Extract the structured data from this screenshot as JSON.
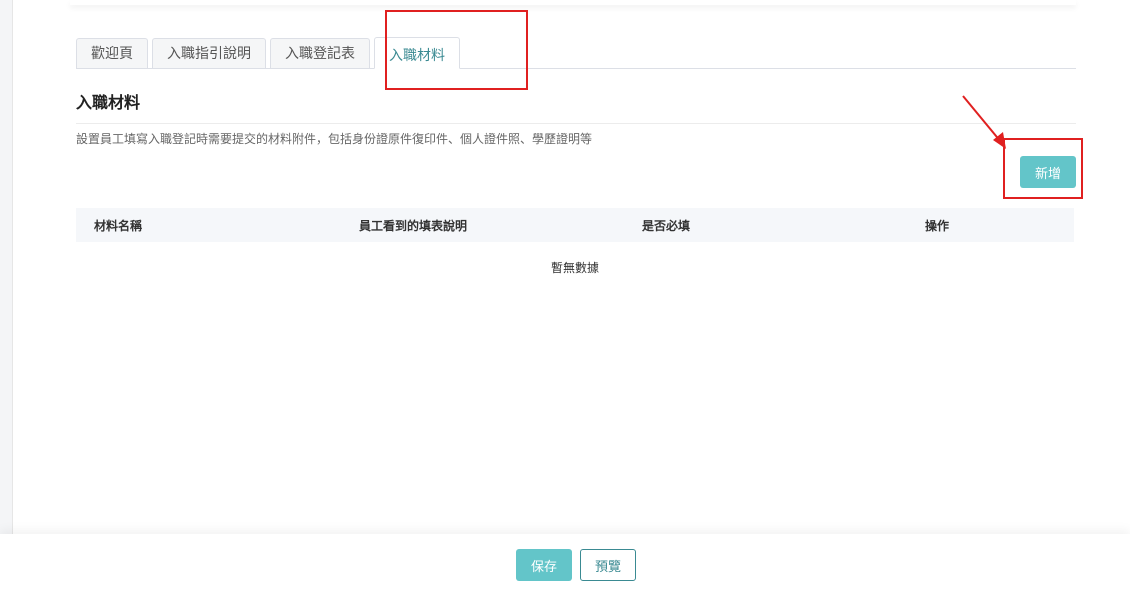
{
  "tabs": [
    {
      "label": "歡迎頁"
    },
    {
      "label": "入職指引說明"
    },
    {
      "label": "入職登記表"
    },
    {
      "label": "入職材料"
    }
  ],
  "section": {
    "title": "入職材料",
    "description": "設置員工填寫入職登記時需要提交的材料附件，包括身份證原件復印件、個人證件照、學歷證明等"
  },
  "add_button": {
    "label": "新增"
  },
  "table": {
    "columns": [
      "材料名稱",
      "員工看到的填表說明",
      "是否必填",
      "操作"
    ],
    "empty_text": "暫無數據"
  },
  "footer": {
    "save_label": "保存",
    "preview_label": "預覽"
  },
  "colors": {
    "accent": "#63c5c9",
    "highlight": "#e02020",
    "active_tab_text": "#3a8a92"
  }
}
